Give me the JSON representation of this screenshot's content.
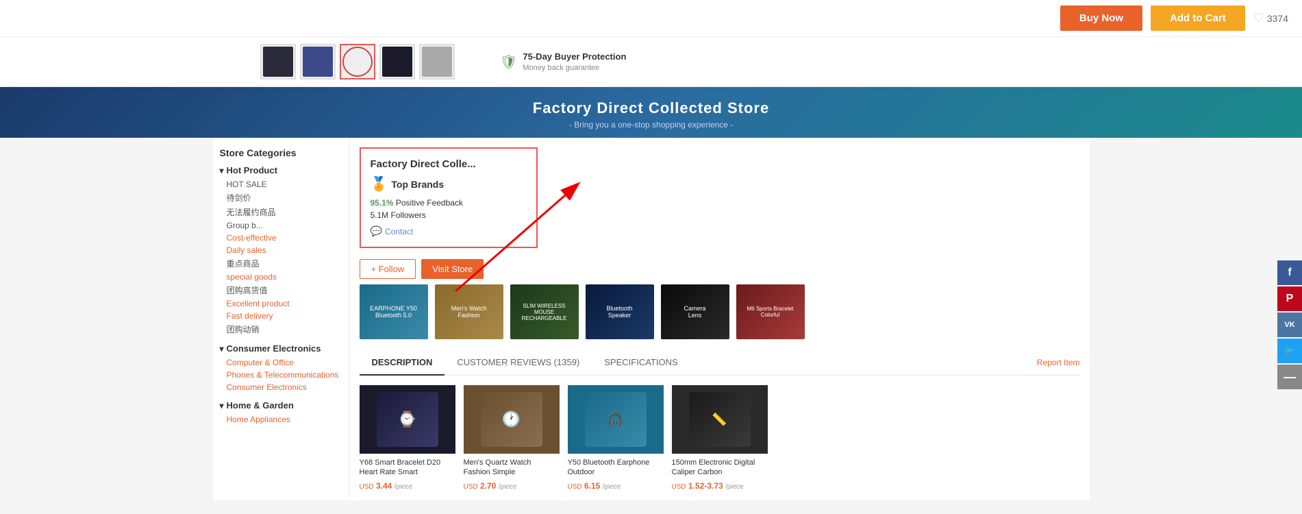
{
  "topBar": {
    "buyNowLabel": "Buy Now",
    "addToCartLabel": "Add to Cart",
    "wishlistCount": "3374"
  },
  "thumbnails": [
    {
      "id": "thumb-1",
      "style": "dark"
    },
    {
      "id": "thumb-2",
      "style": "blue"
    },
    {
      "id": "thumb-3",
      "style": "red-border",
      "active": true
    },
    {
      "id": "thumb-4",
      "style": "dark2"
    },
    {
      "id": "thumb-5",
      "style": "gray"
    }
  ],
  "buyerProtection": {
    "title": "75-Day Buyer Protection",
    "subtitle": "Money back guarantee"
  },
  "storeBanner": {
    "title": "Factory Direct Collected Store",
    "subtitle": "- Bring you a one-stop shopping experience -"
  },
  "sidebar": {
    "title": "Store Categories",
    "hotProduct": {
      "header": "Hot Product",
      "items": [
        "HOT SALE",
        "待剑价",
        "无法履约商品",
        "Group b...",
        "Cost-effective",
        "Daily sales",
        "重点商品",
        "special goods",
        "团购高货值",
        "Excellent product",
        "Fast delivery",
        "团购动销"
      ]
    },
    "consumerElectronics": {
      "header": "Consumer Electronics",
      "items": [
        "Computer & Office",
        "Phones & Telecommunications",
        "Consumer Electronics"
      ]
    },
    "homeGarden": {
      "header": "Home & Garden",
      "items": [
        "Home Appliances"
      ]
    }
  },
  "storeInfo": {
    "name": "Factory Direct Colle...",
    "badge": "🏅",
    "badgeLabel": "Top Brands",
    "feedbackPercent": "95.1%",
    "feedbackLabel": "Positive Feedback",
    "followersCount": "5.1M",
    "followersLabel": "Followers",
    "contactLabel": "Contact"
  },
  "storeActions": {
    "followLabel": "+ Follow",
    "visitLabel": "Visit Store"
  },
  "productThumbs": [
    {
      "label": "EARPHONE Y50\nBluetooth 5.0",
      "style": "pt1"
    },
    {
      "label": "Men's Watch\nFashion",
      "style": "pt2"
    },
    {
      "label": "SLIM WIRELESS MOUSE\nRECHARGEABLE",
      "style": "pt3"
    },
    {
      "label": "Bluetooth\nSpeaker",
      "style": "pt4"
    },
    {
      "label": "Camera\nLens",
      "style": "pt5"
    },
    {
      "label": "M6 Sports Bracelet\nColorful",
      "style": "pt6"
    }
  ],
  "tabs": [
    {
      "label": "DESCRIPTION",
      "active": true
    },
    {
      "label": "CUSTOMER REVIEWS (1359)",
      "active": false
    },
    {
      "label": "SPECIFICATIONS",
      "active": false
    }
  ],
  "reportItem": "Report Item",
  "products": [
    {
      "name": "Y68 Smart Bracelet D20 Heart Rate Smart",
      "price": "3.44",
      "currency": "USD",
      "unit": "/piece",
      "style": "pc1"
    },
    {
      "name": "Men's Quartz Watch Fashion Simple",
      "price": "2.70",
      "currency": "USD",
      "unit": "/piece",
      "style": "pc2"
    },
    {
      "name": "Y50 Bluetooth Earphone Outdoor",
      "price": "6.15",
      "currency": "USD",
      "unit": "/piece",
      "style": "pc3"
    },
    {
      "name": "150mm Electronic Digital Caliper Carbon",
      "price": "1.52-3.73",
      "currency": "USD",
      "unit": "/piece",
      "style": "pc4"
    }
  ],
  "social": [
    {
      "label": "f",
      "style": "social-fb",
      "name": "facebook"
    },
    {
      "label": "P",
      "style": "social-pi",
      "name": "pinterest"
    },
    {
      "label": "VK",
      "style": "social-vk",
      "name": "vk"
    },
    {
      "label": "🐦",
      "style": "social-tw",
      "name": "twitter"
    },
    {
      "label": "—",
      "style": "social-more",
      "name": "more"
    }
  ]
}
